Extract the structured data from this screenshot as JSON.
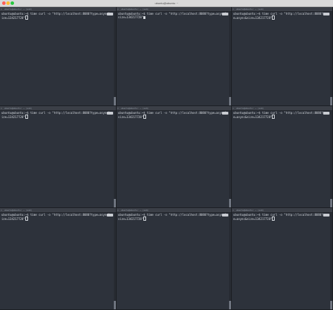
{
  "window": {
    "title": "ubuntu@ubuntu: ~"
  },
  "panes": [
    {
      "header": "ubuntu@ubuntu: ~ (ssh)",
      "line": "ubuntu@ubuntu:~$ time curl -o \"http://localhost:8080?type=async&size=134217728\"",
      "active": false
    },
    {
      "header": "ubuntu@ubuntu: ~ (ssh)",
      "line": "ubuntu@ubuntu:~$ time curl -o \"http://localhost:8080?type=async&size=134217728\"",
      "active": true
    },
    {
      "header": "ubuntu@ubuntu: ~ (ssh)",
      "line": "ubuntu@ubuntu:~$ time curl -o \"http://localhost:8080?type=async&size=134217728\"",
      "active": false
    },
    {
      "header": "ubuntu@ubuntu: ~ (ssh)",
      "line": "ubuntu@ubuntu:~$ time curl -o \"http://localhost:8080?type=async&size=134217728\"",
      "active": false
    },
    {
      "header": "ubuntu@ubuntu: ~ (ssh)",
      "line": "ubuntu@ubuntu:~$ time curl -o \"http://localhost:8080?type=async&size=134217728\"",
      "active": false
    },
    {
      "header": "ubuntu@ubuntu: ~ (ssh)",
      "line": "ubuntu@ubuntu:~$ time curl -o \"http://localhost:8080?type=async&size=134217728\"",
      "active": false
    },
    {
      "header": "ubuntu@ubuntu: ~ (ssh)",
      "line": "ubuntu@ubuntu:~$ time curl -o \"http://localhost:8080?type=async&size=134217728\"",
      "active": false
    },
    {
      "header": "ubuntu@ubuntu: ~ (ssh)",
      "line": "ubuntu@ubuntu:~$ time curl -o \"http://localhost:8080?type=async&size=134217728\"",
      "active": false
    },
    {
      "header": "ubuntu@ubuntu: ~ (ssh)",
      "line": "ubuntu@ubuntu:~$ time curl -o \"http://localhost:8080?type=async&size=134217728\"",
      "active": false
    }
  ],
  "icons": {
    "close": "close-icon",
    "cursor": "cursor-icon"
  },
  "colors": {
    "background": "#2d323b",
    "text": "#d7dbe0",
    "titlebar": "#d9d9d9"
  }
}
